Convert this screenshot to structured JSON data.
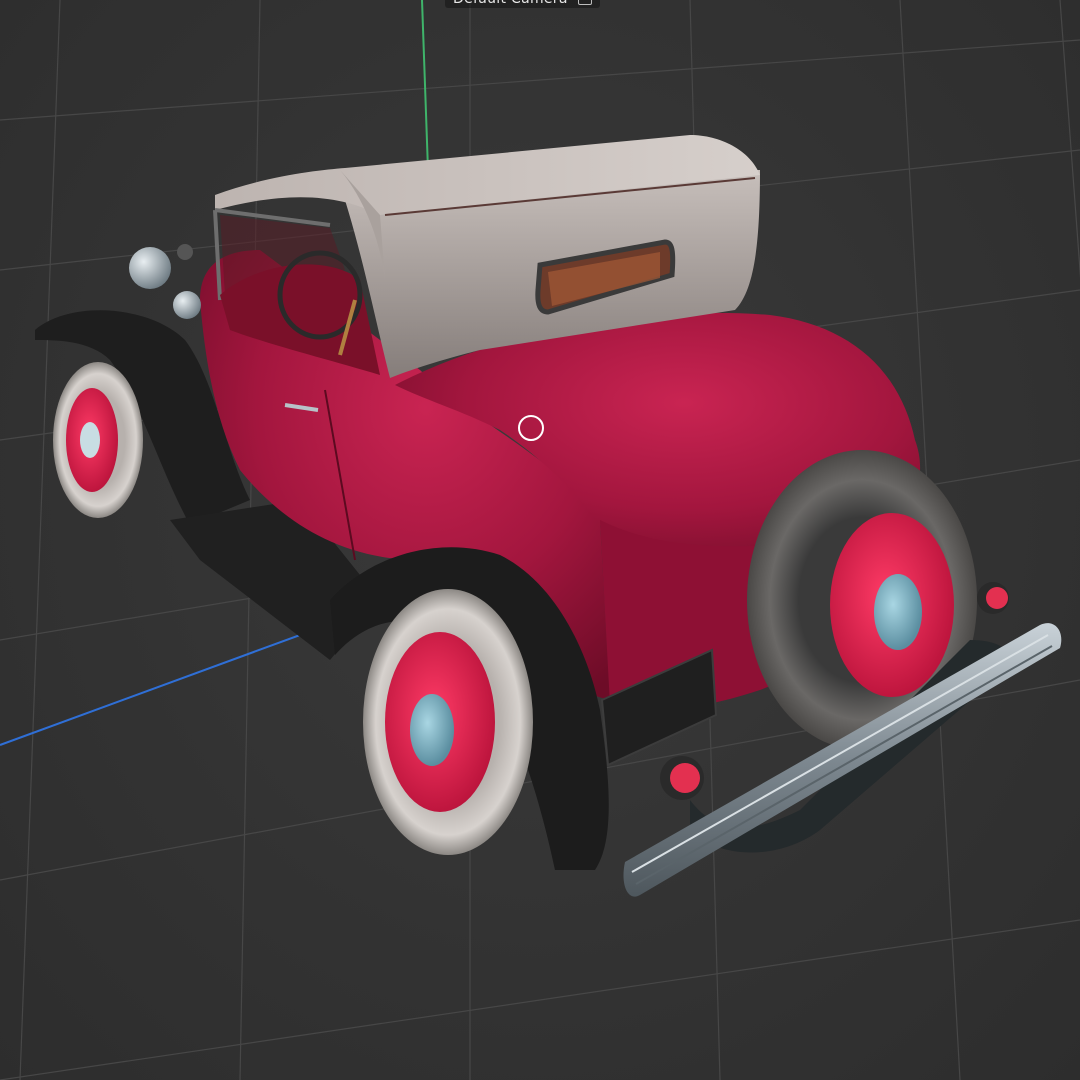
{
  "viewport": {
    "camera_label": "Default Camera",
    "icons": {
      "camera": "camera-icon",
      "cursor": "orbit-cursor-icon"
    }
  },
  "colors": {
    "background": "#333333",
    "grid": "#444444",
    "axis_x": "#2f6fd6",
    "axis_y": "#3fb46a",
    "body_red": "#a3163e",
    "fender_black": "#1f1f1f",
    "top_fabric": "#9b9390",
    "tire_white": "#cfcac6",
    "bumper_chrome": "#8f9aa3"
  }
}
